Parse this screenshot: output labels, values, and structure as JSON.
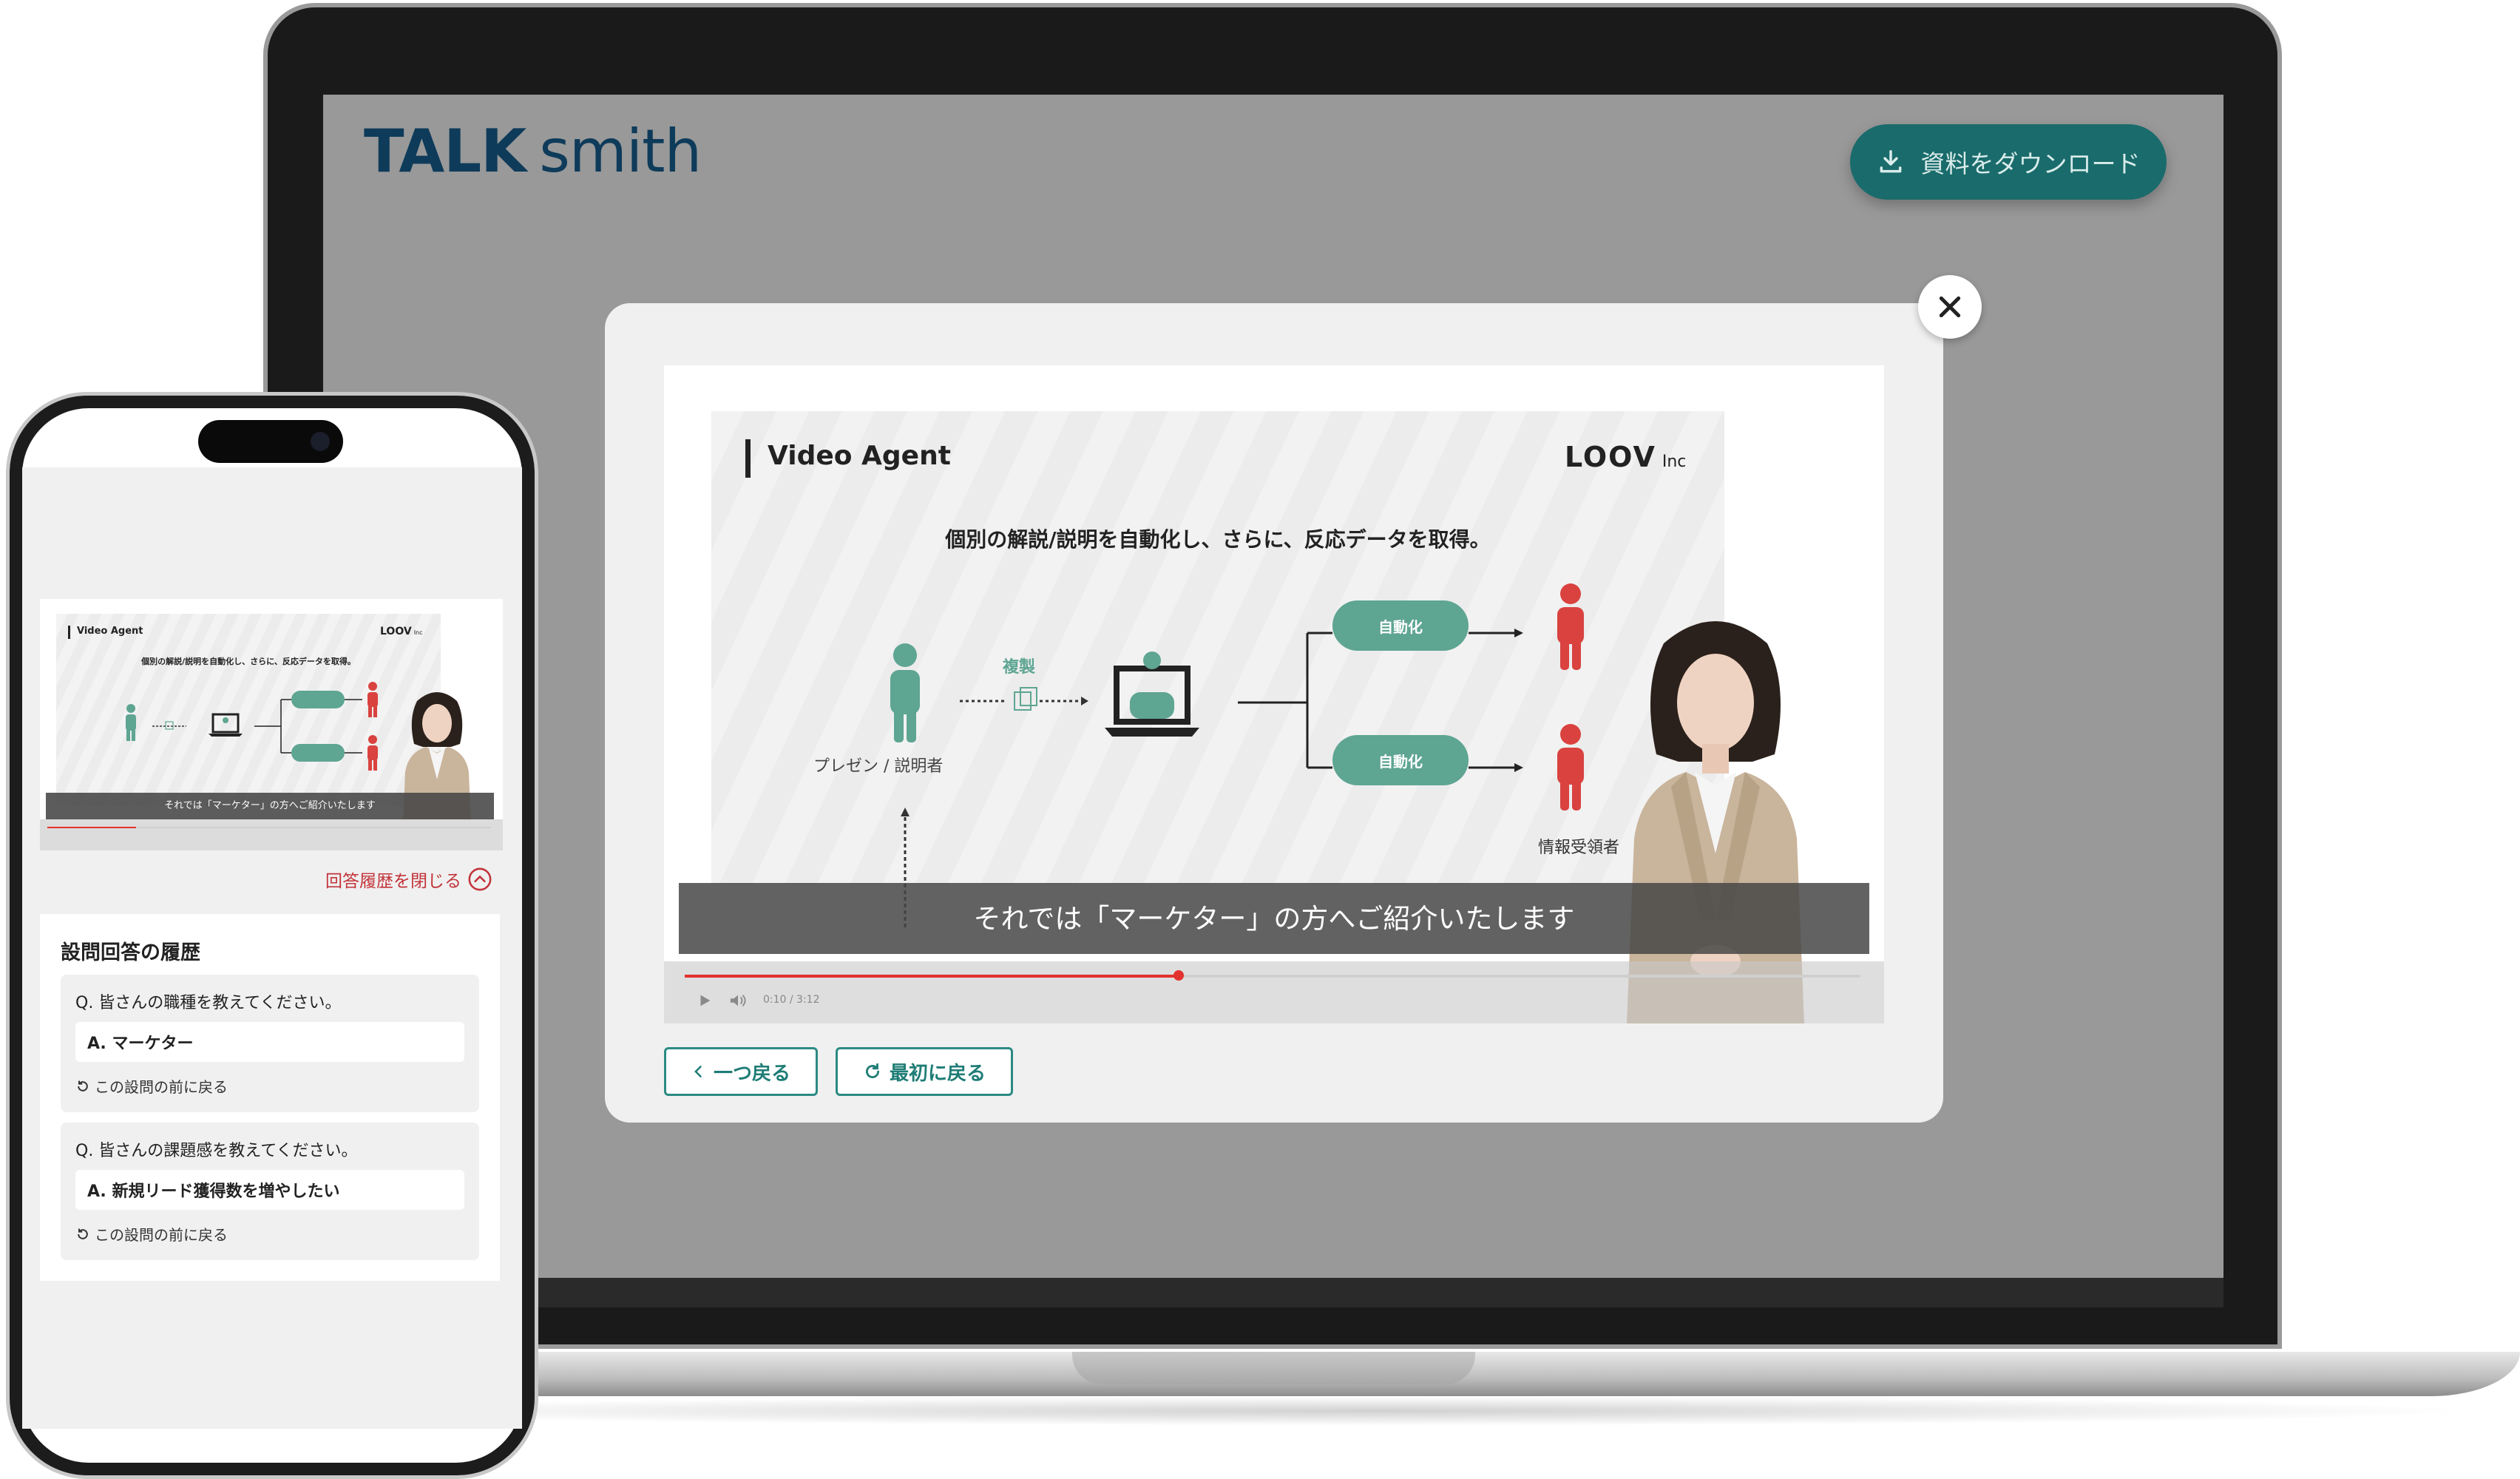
{
  "desktop": {
    "brand": {
      "bold": "TALK",
      "light": "smith"
    },
    "download_label": "資料をダウンロード",
    "slide": {
      "title": "Video Agent",
      "logo": "LOOV",
      "logo_suffix": "Inc",
      "heading": "個別の解説/説明を自動化し、さらに、反応データを取得。",
      "replicate_label": "複製",
      "automate_top": "自動化",
      "automate_bottom": "自動化",
      "presenter_label": "プレゼン / 説明者",
      "receiver_label": "情報受領者"
    },
    "subtitle": "それでは「マーケター」の方へご紹介いたします",
    "progress": 0.42,
    "time": "0:10 / 3:12",
    "back_one_label": "一つ戻る",
    "restart_label": "最初に戻る"
  },
  "mobile": {
    "slide": {
      "title": "Video Agent",
      "logo": "LOOV",
      "logo_suffix": "Inc",
      "heading": "個別の解説/説明を自動化し、さらに、反応データを取得。"
    },
    "subtitle": "それでは「マーケター」の方へご紹介いたします",
    "progress": 0.2,
    "close_history_label": "回答履歴を閉じる",
    "history_title": "設問回答の履歴",
    "qa": [
      {
        "question": "Q. 皆さんの職種を教えてください。",
        "answer": "A. マーケター",
        "back": "この設問の前に戻る"
      },
      {
        "question": "Q. 皆さんの課題感を教えてください。",
        "answer": "A. 新規リード獲得数を増やしたい",
        "back": "この設問の前に戻る"
      }
    ]
  },
  "colors": {
    "teal": "#1a6b6b",
    "green": "#5ea592",
    "red": "#d9423f",
    "accent_red": "#c2343a",
    "progress_red": "#e3312d"
  }
}
